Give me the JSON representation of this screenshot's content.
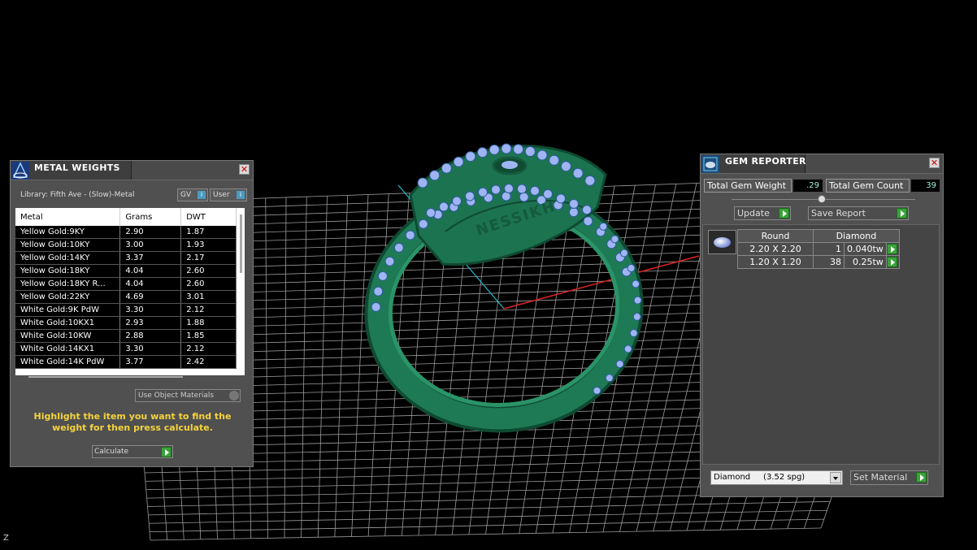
{
  "viewport": {
    "axis_label": "Z",
    "ring_engraving": "NESSIKH"
  },
  "metal_weights": {
    "title": "METAL WEIGHTS",
    "library_label": "Library: Fifth Ave - (Slow)-Metal",
    "toggle_gv": "GV",
    "toggle_user": "User",
    "columns": [
      "Metal",
      "Grams",
      "DWT"
    ],
    "rows": [
      [
        "Yellow Gold:9KY",
        "2.90",
        "1.87"
      ],
      [
        "Yellow Gold:10KY",
        "3.00",
        "1.93"
      ],
      [
        "Yellow Gold:14KY",
        "3.37",
        "2.17"
      ],
      [
        "Yellow Gold:18KY",
        "4.04",
        "2.60"
      ],
      [
        "Yellow Gold:18KY R...",
        "4.04",
        "2.60"
      ],
      [
        "Yellow Gold:22KY",
        "4.69",
        "3.01"
      ],
      [
        "White Gold:9K PdW",
        "3.30",
        "2.12"
      ],
      [
        "White Gold:10KX1",
        "2.93",
        "1.88"
      ],
      [
        "White Gold:10KW",
        "2.88",
        "1.85"
      ],
      [
        "White Gold:14KX1",
        "3.30",
        "2.12"
      ],
      [
        "White Gold:14K PdW",
        "3.77",
        "2.42"
      ]
    ],
    "use_object_materials": "Use Object Materials",
    "hint": "Highlight the item you want to find the weight for then press calculate.",
    "calculate_label": "Calculate"
  },
  "gem_reporter": {
    "title": "GEM REPORTER",
    "total_gem_weight_label": "Total Gem Weight",
    "total_gem_weight_value": ".29",
    "total_gem_count_label": "Total Gem Count",
    "total_gem_count_value": "39",
    "update_label": "Update",
    "save_report_label": "Save Report",
    "table_headers": [
      "Round",
      "Diamond"
    ],
    "rows": [
      {
        "size": "2.20 X 2.20",
        "count": "1",
        "weight": "0.040tw"
      },
      {
        "size": "1.20 X 1.20",
        "count": "38",
        "weight": "0.25tw"
      }
    ],
    "material_select": "Diamond     (3.52 spg)",
    "set_material_label": "Set Material"
  },
  "colors": {
    "ring": "#1e7a55",
    "gems": "#9fb4f2",
    "grid": "#d0d0d0",
    "accent_green": "#3aa33a"
  }
}
